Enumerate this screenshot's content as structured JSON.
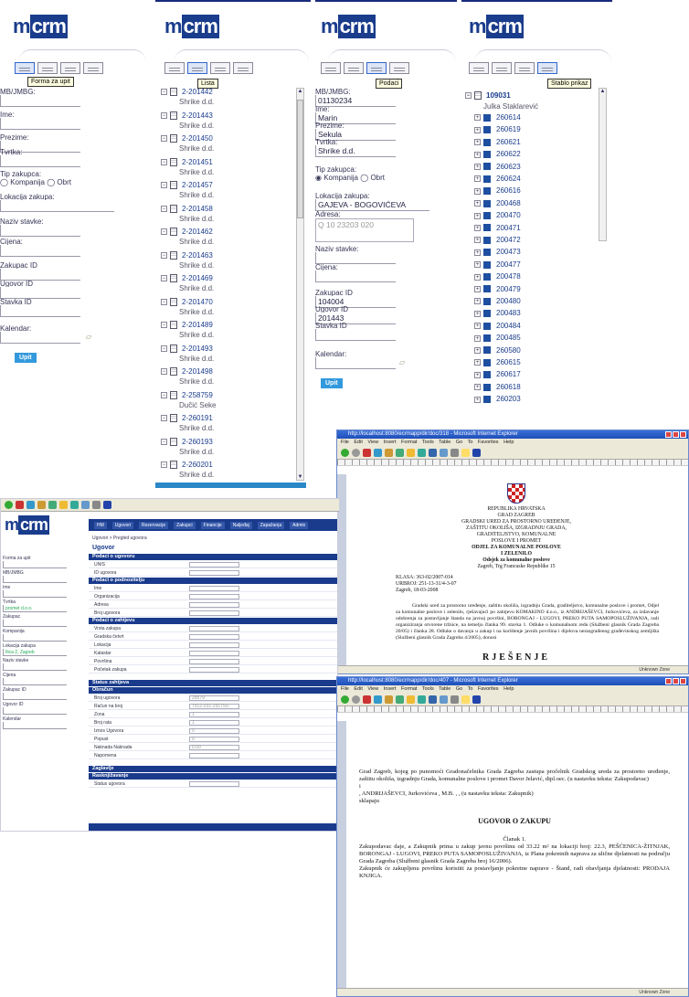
{
  "brand": {
    "logo_m": "m",
    "logo_crm": "crm"
  },
  "panel1": {
    "tooltip": "Forma za upit",
    "fields": [
      {
        "label": "MB/JMBG:",
        "value": ""
      },
      {
        "label": "Ime:",
        "value": ""
      },
      {
        "label": "Prezime:",
        "value": ""
      },
      {
        "label": "Tvrtka:",
        "value": ""
      }
    ],
    "tip_zakupca": "Tip zakupca:",
    "radio_kompanija": "Kompanija",
    "radio_obrt": "Obrt",
    "lokacija": "Lokacija zakupa:",
    "naziv": "Naziv stavke:",
    "cijena": "Cijena:",
    "zakupac_id": "Zakupac ID",
    "ugovor_id": "Ugovor ID",
    "stavka_id": "Stavka ID",
    "kalendar": "Kalendar:",
    "submit": "Upit"
  },
  "panel2": {
    "tooltip": "Lista",
    "items": [
      {
        "code": "2-201442",
        "company": "Shrike d.d."
      },
      {
        "code": "2-201443",
        "company": "Shrike d.d."
      },
      {
        "code": "2-201450",
        "company": "Shrike d.d."
      },
      {
        "code": "2-201451",
        "company": "Shrike d.d."
      },
      {
        "code": "2-201457",
        "company": "Shrike d.d."
      },
      {
        "code": "2-201458",
        "company": "Shrike d.d."
      },
      {
        "code": "2-201462",
        "company": "Shrike d.d."
      },
      {
        "code": "2-201463",
        "company": "Shrike d.d."
      },
      {
        "code": "2-201469",
        "company": "Shrike d.d."
      },
      {
        "code": "2-201470",
        "company": "Shrike d.d."
      },
      {
        "code": "2-201489",
        "company": "Shrike d.d."
      },
      {
        "code": "2-201493",
        "company": "Shrike d.d."
      },
      {
        "code": "2-201498",
        "company": "Shrike d.d."
      },
      {
        "code": "2-258759",
        "company": "Dučić Seke"
      },
      {
        "code": "2-260191",
        "company": "Shrike d.d."
      },
      {
        "code": "2-260193",
        "company": "Shrike d.d."
      },
      {
        "code": "2-260201",
        "company": "Shrike d.d."
      }
    ]
  },
  "panel3": {
    "tooltip": "Podaci",
    "mb_label": "MB/JMBG:",
    "mb_value": "01130234",
    "ime_label": "Ime:",
    "ime_value": "Marin",
    "prezime_label": "Prezime:",
    "prezime_value": "Sekula",
    "tvrtka_label": "Tvrtka:",
    "tvrtka_value": "Shrike d.d.",
    "tip_zakupca": "Tip zakupca:",
    "radio_kompanija": "Kompanija",
    "radio_obrt": "Obrt",
    "lokacija_label": "Lokacija zakupa:",
    "lokacija_value": "GAJEVA - BOGOVIĆEVA",
    "adresa_label": "Adresa:",
    "adresa_value": "Q 10 23203 020",
    "naziv": "Naziv stavke:",
    "cijena": "Cijena:",
    "zakupac_label": "Zakupac ID",
    "zakupac_value": "104004",
    "ugovor_label": "Ugovor ID",
    "ugovor_value": "201443",
    "stavka_label": "Stavka ID",
    "kalendar": "Kalendar:",
    "submit": "Upit"
  },
  "panel4": {
    "tooltip": "Stablo prikaz",
    "root_code": "109031",
    "root_name": "Julka Staklarević",
    "items": [
      "260614",
      "260619",
      "260621",
      "260622",
      "260623",
      "260624",
      "260616",
      "200468",
      "200470",
      "200471",
      "200472",
      "200473",
      "200477",
      "200478",
      "200479",
      "200480",
      "200483",
      "200484",
      "200485",
      "260580",
      "260615",
      "260617",
      "260618",
      "260203"
    ]
  },
  "window1": {
    "title": "http://localhost:8080/ecrmapp/dir/doc/318 - Microsoft Internet Explorer",
    "menu": "File  Edit  View  Insert  Format  Tools  Table  Go To  Favorites  Help",
    "lines": [
      "REPUBLIKA HRVATSKA",
      "GRAD ZAGREB",
      "GRADSKI URED ZA PROSTORNO UREĐENJE,",
      "ZAŠTITU OKOLIŠA, IZGRADNJU GRADA,",
      "GRADITELJSTVO, KOMUNALNE",
      "POSLOVE I PROMET",
      "ODJEL ZA KOMUNALNE POSLOVE",
      "I ZELENILO",
      "Odsjek za komunalne poslove",
      "Zagreb, Trg Francuske Republike 15"
    ],
    "klasa": "KLASA: 363-02/2007-014",
    "urbroj": "URBROJ: 251-13-31/4-3-07",
    "datum": "Zagreb, 18-03-2008",
    "para": "Gradski ured za prostorno uređenje, zaštitu okoliša, izgradnju Grada, graditeljstvo, komunalne poslove i promet, Odjel za komunalne poslove i zelenilo, rješavajući po zahtjevu KOMAKINO d.o.o., iz ANDRIJAŠEVCI, Jurkovićeva, za izdavanje odobrenja za postavljanje štanda na javnoj površini, BORONGAJ - LUGOVI, PREKO PUTA SAMOPOSLUŽIVANJA, radi organiziranja otvorene tržnice, na temelju članka 99. stavka 1. Odluke o komunalnom redu (Službeni glasnik Grada Zagreba 20/05) i članka 28. Odluke o davanju u zakup i na korištenje javnih površina i dijelova nerazgrađenog građevinskog zemljišta (Službeni glasnik Grada Zagreba 4/2005), donosi",
    "heading": "RJEŠENJE",
    "zone": "Unknown Zone"
  },
  "window2": {
    "title": "http://localhost:8080/ecrmapp/dir/doc/407 - Microsoft Internet Explorer",
    "menu": "File  Edit  View  Insert  Format  Tools  Table  Go To  Favorites  Help",
    "p1": "Grad Zagreb, kojeg po punomoći Gradonačelnika Grada Zagreba zastupa pročelnik Gradskog ureda za prostorno uređenje, zaštitu okoliša, izgradnju Grada, komunalne poslove i promet Davor Jelavić, dipl.oec. (u nastavku teksta: Zakupodavac)",
    "p2": "i",
    "p3": ", ANDRIJAŠEVCI, Jurkovićeva , M.B. , , (u nastavku teksta: Zakupnik)",
    "p4": "sklapaju",
    "heading": "UGOVOR O ZAKUPU",
    "clanak": "Članak 1.",
    "p5": "Zakupodavac daje, a Zakupnik prima u zakup javnu površinu od 33.22 m² na lokaciji broj: 22.3, PEŠĆENICA-ŽITNJAK, BORONGAJ - LUGOVI, PREKO PUTA SAMOPOSLUŽIVANJA, iz Plana pokretnih naprava za ulične djelatnosti na području Grada Zagreba (Službeni glasnik Grada Zagreba broj 16/2006).",
    "p6": "Zakupnik će zakupljenu površinu koristiti za postavljanje pokretne naprave - Štand, radi obavljanja djelatnosti: PRODAJA KNJIGA.",
    "zone": "Unknown Zone"
  },
  "app": {
    "nav": [
      "HM",
      "Ugovori",
      "Rezervacije",
      "Zakupci",
      "Financije",
      "Naljeđaj",
      "Zapažanja",
      "Admin"
    ],
    "breadcrumb": "Ugovori > Pregled ugovora",
    "title": "Ugovor",
    "sections": [
      "Podaci o ugovoru",
      "Podaci o podnositelju",
      "Podaci o zahtjevu",
      "Status zahtjeva",
      "Obračun",
      "Zaglavlje",
      "Rasknjižavanje"
    ],
    "rows1": [
      "UNIS",
      "ID ugovora"
    ],
    "rows2": [
      "Ime",
      "Organizacija",
      "Adresa",
      "Broj ugovora"
    ],
    "rows3": [
      "Vrsta zakupa",
      "Gradska četvrt",
      "Lokacija",
      "Katastar",
      "Površina",
      "Početak zakupa"
    ],
    "rows5": [
      "Broj ugovora",
      "Račun na broj",
      "Zona",
      "Broj rata",
      "Iznos Ugovora",
      "Popust",
      "Naknada Naknada",
      "Napomena"
    ],
    "vals5": [
      "29579",
      "7912-031-291793-",
      "1",
      "1",
      "0",
      "0",
      "0.00",
      ""
    ],
    "rows7": [
      "Status ugovora"
    ],
    "left_fields": [
      "Forma za upit",
      "MB/JMBG",
      "Ime",
      "Tvrtka",
      "Zakupac",
      "Kompanija",
      "Lokacija zakupa",
      "Naziv stavke",
      "Cijena",
      "Zakupac ID",
      "Ugovor ID",
      "Kalendar"
    ],
    "left_value": "promet d.o.o.",
    "left_loc": "Ilica 2, Zagreb"
  }
}
